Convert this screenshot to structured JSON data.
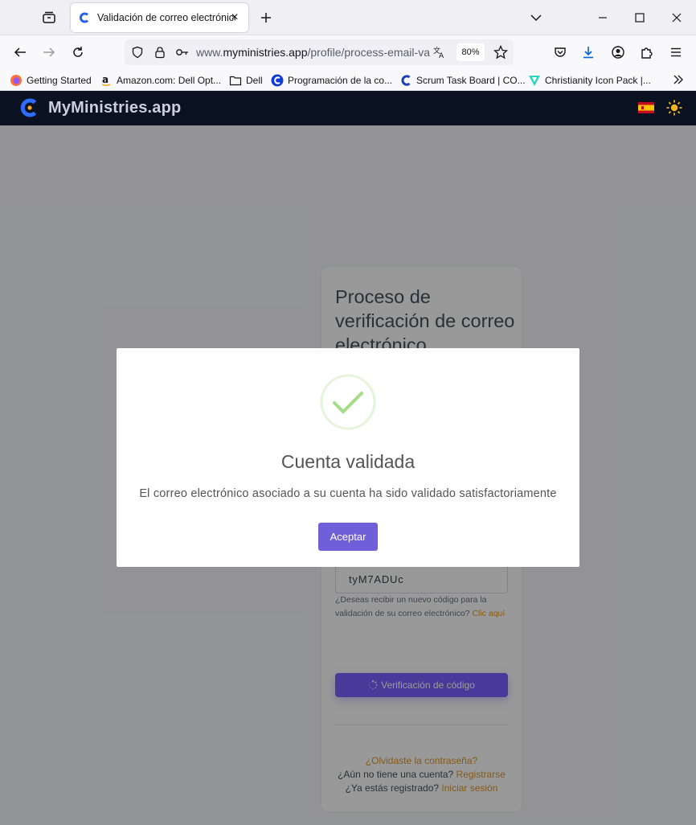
{
  "browser": {
    "tab_title": "Validación de correo electrónico",
    "url_prefix": "www.",
    "url_domain": "myministries.app",
    "url_path": "/profile/process-email-va",
    "zoom": "80%",
    "bookmarks": [
      {
        "label": "Getting Started",
        "icon": "firefox-icon"
      },
      {
        "label": "Amazon.com: Dell Opt...",
        "icon": "amazon-icon"
      },
      {
        "label": "Dell",
        "icon": "folder-icon"
      },
      {
        "label": "Programación de la co...",
        "icon": "c-logo-icon"
      },
      {
        "label": "Scrum Task Board | CO...",
        "icon": "c-logo-icon"
      },
      {
        "label": "Christianity Icon Pack |...",
        "icon": "icon-pack-icon"
      }
    ]
  },
  "app": {
    "brand": "MyMinistries.app",
    "language_flag": "es"
  },
  "card": {
    "title": "Proceso de verificación de correo electrónico",
    "code_value": "tyM7ADUc",
    "resend_prompt": "¿Deseas recibir un nuevo código para la validación de su correo electrónico?",
    "resend_link": "Clic aquí",
    "verify_button": "Verificación de código",
    "forgot_password": "¿Olvidaste la contraseña?",
    "no_account": "¿Aún no tiene una cuenta?",
    "register_link": "Registrarse",
    "already_registered": "¿Ya estás registrado?",
    "login_link": "Iniciar sesión"
  },
  "modal": {
    "title": "Cuenta validada",
    "message": "El correo electrónico asociado a su cuenta ha sido validado satisfactoriamente",
    "accept_button": "Aceptar"
  },
  "colors": {
    "header_bg": "#0a1120",
    "accent_purple": "#7b61ff",
    "link_orange": "#e0962a",
    "success_green": "#a5dc86"
  }
}
